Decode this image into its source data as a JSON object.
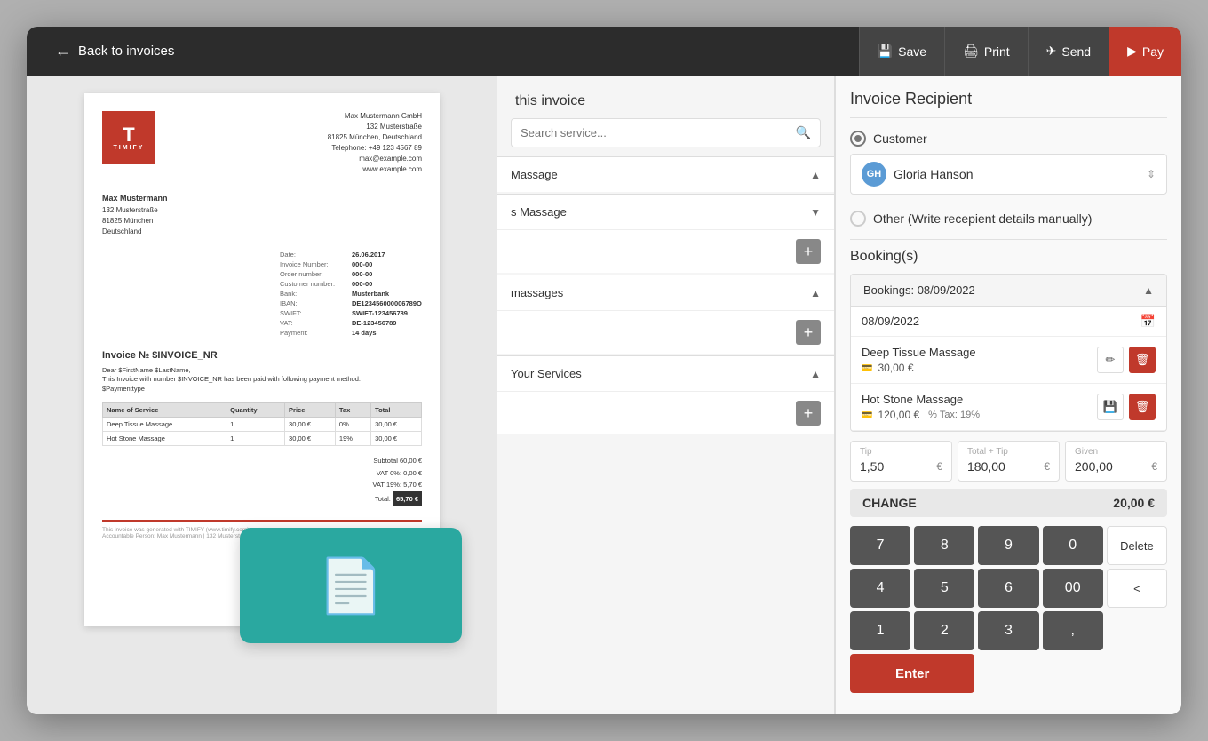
{
  "topBar": {
    "backLabel": "Back to invoices",
    "saveLabel": "Save",
    "printLabel": "Print",
    "sendLabel": "Send",
    "payLabel": "Pay"
  },
  "invoiceDoc": {
    "logoText": "T",
    "logoSubtext": "TIMIFY",
    "companyName": "Max Mustermann GmbH",
    "companyAddress": "132 Musterstraße",
    "companyCity": "81825 München, Deutschland",
    "telephone": "Telephone: +49 123 4567 89",
    "email": "max@example.com",
    "website": "www.example.com",
    "date": "26.06.2017",
    "invoiceNumber": "000-00",
    "orderNumber": "000-00",
    "customerNumber": "000-00",
    "bank": "Musterbank",
    "iban": "DE123456000006789O",
    "swift": "SWIFT-123456789",
    "vat": "DE-123456789",
    "payment": "14 days",
    "clientName": "Max Mustermann",
    "clientStreet": "132 Musterstraße",
    "clientCity": "81825 München",
    "clientCountry": "Deutschland",
    "invoiceTitleLine": "Invoice № $INVOICE_NR",
    "greeting": "Dear $FirstName $LastName,",
    "bodyText": "This Invoice with number $INVOICE_NR has been paid with following payment method:",
    "paymentType": "$Paymenttype",
    "tableHeaders": [
      "Name of Service",
      "Quantity",
      "Price",
      "Tax",
      "Total"
    ],
    "tableRows": [
      [
        "Deep Tissue Massage",
        "1",
        "30,00 €",
        "0%",
        "30,00 €"
      ],
      [
        "Hot Stone Massage",
        "1",
        "30,00 €",
        "19%",
        "30,00 €"
      ]
    ],
    "subtotal": "60,00 €",
    "vat0": "0,00 €",
    "vat19": "5,70 €",
    "total": "65,70 €",
    "footerText": "This invoice was generated with TIMIFY (www.timify.com)",
    "footerCompany": "Max Mustermann GmbH",
    "footerDetails": "Accountable Person: Max Mustermann | 132 Musterstraße | HRB-Nr: 987654"
  },
  "servicesPanel": {
    "title": "this invoice",
    "searchPlaceholder": "Search service...",
    "categories": [
      {
        "name": "Massage",
        "expanded": false
      },
      {
        "name": "s Massage",
        "expanded": true,
        "items": []
      },
      {
        "name": "massages",
        "expanded": true
      },
      {
        "name": "Your Services",
        "expanded": true
      }
    ]
  },
  "rightPanel": {
    "recipientTitle": "Invoice Recipient",
    "customerLabel": "Customer",
    "otherLabel": "Other (Write recepient details manually)",
    "selectedCustomer": "Gloria Hanson",
    "customerInitials": "GH",
    "bookingsTitle": "Booking(s)",
    "bookingDateLabel": "Bookings: 08/09/2022",
    "bookingDate": "08/09/2022",
    "services": [
      {
        "name": "Deep Tissue Massage",
        "price": "30,00 €",
        "taxLabel": ""
      },
      {
        "name": "Hot Stone Massage",
        "price": "120,00 €",
        "taxLabel": "Tax: 19%"
      }
    ],
    "tipLabel": "Tip",
    "tipValue": "1,50",
    "totalPlusTipLabel": "Total + Tip",
    "totalPlusTipValue": "180,00",
    "givenLabel": "Given",
    "givenValue": "200,00",
    "currency": "€",
    "changeLabel": "CHANGE",
    "changeAmount": "20,00 €",
    "numpad": {
      "keys": [
        "7",
        "8",
        "9",
        "0",
        "4",
        "5",
        "6",
        "00",
        "1",
        "2",
        "3",
        ","
      ],
      "deleteLabel": "Delete",
      "backLabel": "<",
      "enterLabel": "Enter"
    }
  }
}
